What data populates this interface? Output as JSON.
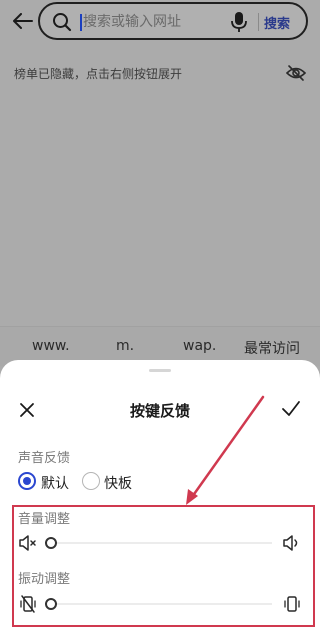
{
  "browser": {
    "search": {
      "placeholder": "搜索或输入网址",
      "button_label": "搜索"
    },
    "hidden_notice": "榜单已隐藏，点击右侧按钮展开",
    "quick_keys": [
      "www.",
      "m.",
      "wap.",
      "最常访问"
    ]
  },
  "sheet": {
    "title": "按键反馈",
    "sound_feedback": {
      "label": "声音反馈",
      "options": [
        "默认",
        "快板"
      ],
      "selected": "默认"
    },
    "volume": {
      "label": "音量调整",
      "level": 0
    },
    "vibration": {
      "label": "振动调整",
      "level": 0
    }
  },
  "colors": {
    "accent": "#2b47d0",
    "annotation": "#d0394f",
    "dim_overlay": "#ababab"
  },
  "icons": [
    "back-arrow-icon",
    "search-icon",
    "mic-icon",
    "eye-hidden-icon",
    "close-icon",
    "check-icon",
    "volume-mute-icon",
    "volume-up-icon",
    "vibrate-off-icon",
    "vibrate-icon"
  ]
}
